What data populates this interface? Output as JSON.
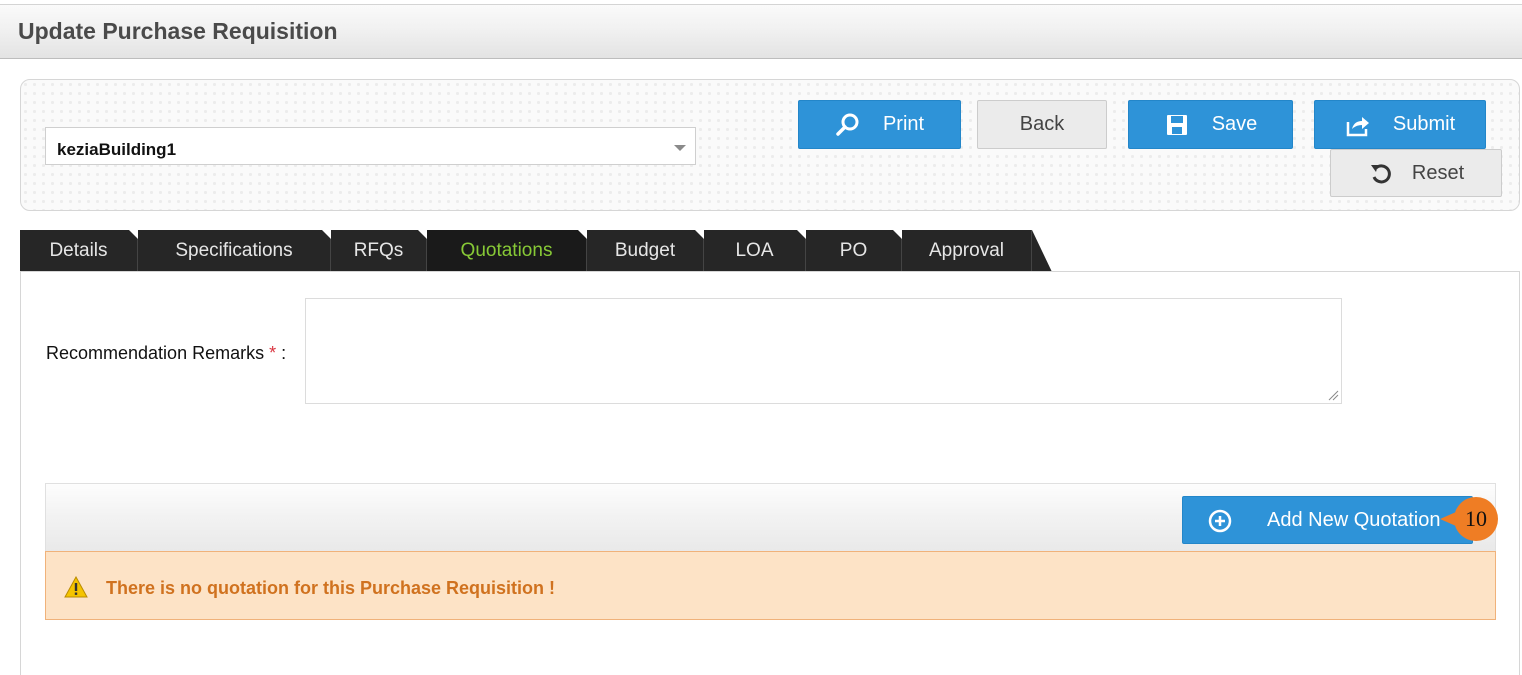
{
  "page": {
    "title": "Update Purchase Requisition"
  },
  "building_select": {
    "value": "keziaBuilding1"
  },
  "actions": {
    "print": "Print",
    "back": "Back",
    "save": "Save",
    "submit": "Submit",
    "reset": "Reset"
  },
  "tabs": [
    {
      "label": "Details"
    },
    {
      "label": "Specifications"
    },
    {
      "label": "RFQs"
    },
    {
      "label": "Quotations",
      "active": true
    },
    {
      "label": "Budget"
    },
    {
      "label": "LOA"
    },
    {
      "label": "PO"
    },
    {
      "label": "Approval"
    }
  ],
  "form": {
    "remarks_label": "Recommendation Remarks",
    "required_mark": "*",
    "label_suffix": ":",
    "remarks_value": ""
  },
  "quotations": {
    "add_button": "Add New Quotation",
    "empty_message": "There is no quotation for this Purchase Requisition !"
  },
  "annotation": {
    "step": "10"
  },
  "colors": {
    "primary": "#2e93d8",
    "active_tab_text": "#87c936",
    "warning_bg": "#fde3c6",
    "warning_text": "#d0721f",
    "badge": "#ef7d24"
  }
}
